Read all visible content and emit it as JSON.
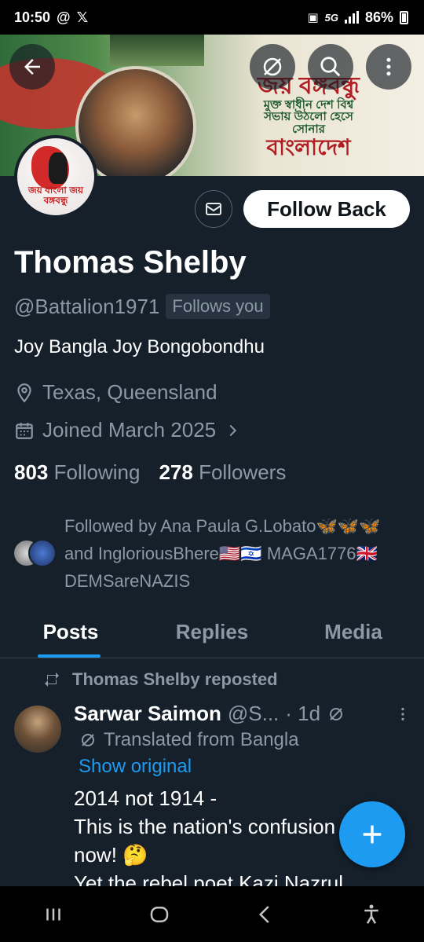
{
  "status_bar": {
    "time": "10:50",
    "left_icons": [
      "at-sign-icon",
      "x-logo-icon"
    ],
    "network": "5G",
    "battery": "86%"
  },
  "banner": {
    "headline_top": "জয় বঙ্গবন্ধু",
    "headline_mid": "মুক্ত স্বাধীন দেশ বিশ্ব সভায় উঠলো হেসে সোনার",
    "headline_bottom": "বাংলাদেশ"
  },
  "avatar": {
    "caption": "জয় বাংলা জয় বঙ্গবন্ধু"
  },
  "profile": {
    "follow_button": "Follow Back",
    "name": "Thomas Shelby",
    "handle": "@Battalion1971",
    "follows_you": "Follows you",
    "bio": "Joy Bangla Joy Bongobondhu",
    "location": "Texas, Queensland",
    "joined": "Joined March 2025",
    "following_count": "803",
    "following_label": "Following",
    "followers_count": "278",
    "followers_label": "Followers",
    "followed_by": "Followed by Ana Paula G.Lobato🦋🦋🦋 and IngloriousBhere🇺🇸🇮🇱 MAGA1776🇬🇧DEMSareNAZIS"
  },
  "tabs": [
    {
      "label": "Posts",
      "active": true
    },
    {
      "label": "Replies",
      "active": false
    },
    {
      "label": "Media",
      "active": false
    }
  ],
  "post": {
    "repost_label": "Thomas Shelby reposted",
    "author_name": "Sarwar Saimon",
    "author_handle": "@S...",
    "time": "· 1d",
    "translated_label": "Translated from Bangla",
    "show_original": "Show original",
    "body_line1": "2014 not 1914 -",
    "body_line2": "This is the nation's confusion",
    "body_line3": "now! 🤔",
    "body_line4": "Yet the rebel poet Kazi Nazrul"
  },
  "colors": {
    "background": "#15202b",
    "accent": "#1d9bf0",
    "muted_text": "#8b98a5"
  }
}
